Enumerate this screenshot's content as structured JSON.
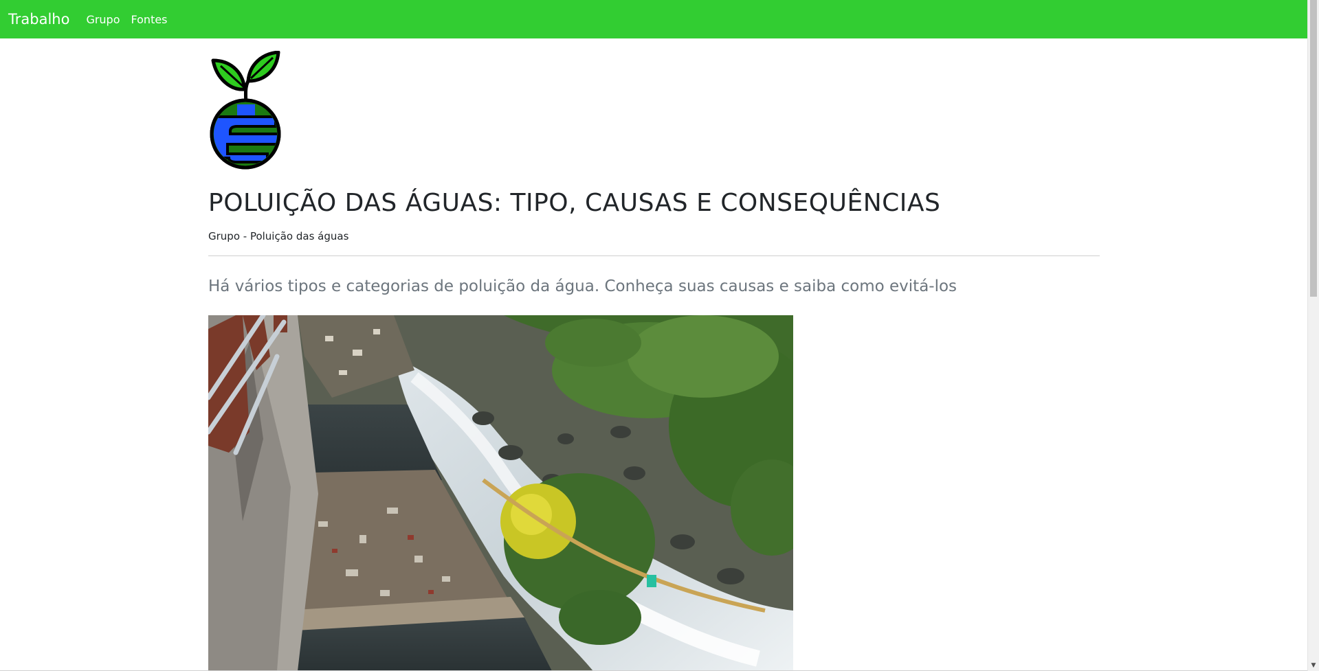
{
  "navbar": {
    "brand": "Trabalho",
    "links": [
      "Grupo",
      "Fontes"
    ],
    "background_color": "#32cd32"
  },
  "header": {
    "logo_icon": "earth-sprout-icon",
    "title": "POLUIÇÃO DAS ÁGUAS: TIPO, CAUSAS E CONSEQUÊNCIAS",
    "byline": "Grupo - Poluição das águas"
  },
  "article": {
    "lead": "Há vários tipos e categorias de poluição da água. Conheça suas causas e saiba como evitá-los",
    "photo_icon": "polluted-river-photo"
  },
  "colors": {
    "accent": "#32cd32",
    "text": "#212529",
    "muted": "#6c757d"
  }
}
